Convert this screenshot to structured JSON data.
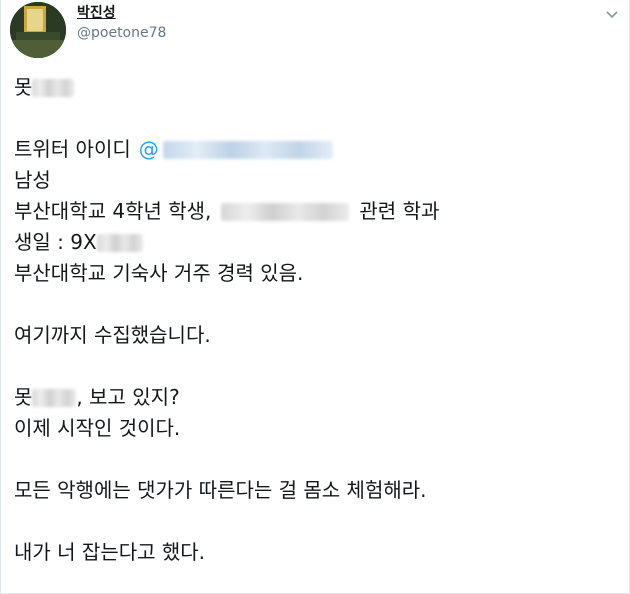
{
  "header": {
    "display_name": "박진성",
    "handle": "@poetone78",
    "menu_icon": "chevron-down-icon",
    "avatar_icon": "avatar"
  },
  "tweet": {
    "line1": "못",
    "line3_prefix": "트위터 아이디",
    "line3_mention": "@",
    "line4": "남성",
    "line5_prefix": "부산대학교 4학년 학생,",
    "line5_suffix": "관련 학과",
    "line6_prefix": "생일 : 9X",
    "line7": "부산대학교 기숙사 거주 경력 있음.",
    "line9": "여기까지 수집했습니다.",
    "line11_prefix": "못",
    "line11_suffix": ", 보고 있지?",
    "line12": "이제 시작인 것이다.",
    "line14": "모든 악행에는 댓가가 따른다는 걸 몸소 체험해라.",
    "line16": "내가 너 잡는다고 했다."
  },
  "colors": {
    "text": "#14171a",
    "secondary": "#657786",
    "link": "#1da1f2",
    "border": "#e1e8ed"
  }
}
